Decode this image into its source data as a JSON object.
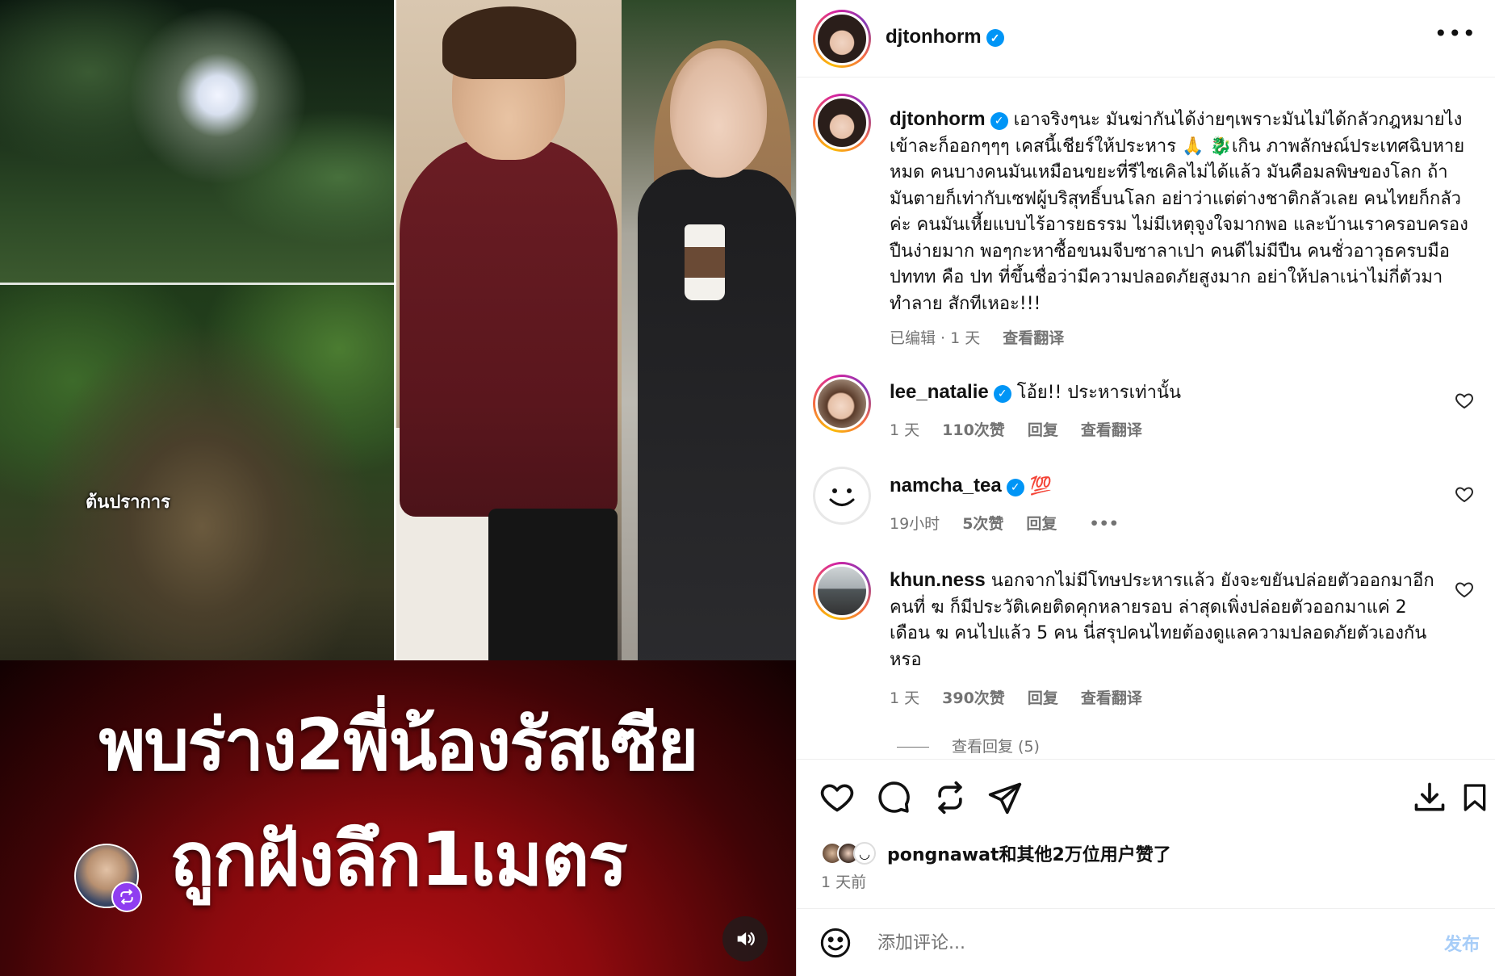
{
  "media": {
    "headline_line1": "พบร่าง2พี่น้องรัสเซีย",
    "headline_line2": "ถูกฝังลึก1เมตร",
    "inset_label": "ต้นปราการ",
    "repost_icon": "repost-icon",
    "sound_icon": "speaker-icon"
  },
  "post": {
    "username": "djtonhorm",
    "more_icon": "more-dots-icon"
  },
  "caption": {
    "username": "djtonhorm",
    "text": "เอาจริงๆนะ มันฆ่ากันได้ง่ายๆเพราะมันไม่ได้กลัวกฎหมายไง เข้าละก็ออกๆๆๆ เคสนี้เชียร์ให้ประหาร 🙏 🐉เกิน ภาพลักษณ์ประเทศฉิบหายหมด คนบางคนมันเหมือนขยะที่รีไซเคิลไม่ได้แล้ว มันคือมลพิษของโลก ถ้ามันตายก็เท่ากับเซฟผู้บริสุทธิ์บนโลก อย่าว่าแต่ต่างชาติกลัวเลย คนไทยก็กลัวค่ะ คนมันเหี้ยแบบไร้อารยธรรม ไม่มีเหตุจูงใจมากพอ และบ้านเราครอบครองปืนง่ายมาก พอๆกะหาซื้อขนมจีบซาลาเปา คนดีไม่มีปืน คนชั่วอาวุธครบมือ ปททท คือ ปท ที่ขึ้นชื่อว่ามีความปลอดภัยสูงมาก อย่าให้ปลาเน่าไม่กี่ตัวมาทำลาย สักทีเหอะ!!!",
    "edited": "已编辑 · 1 天",
    "translate": "查看翻译"
  },
  "comments": [
    {
      "username": "lee_natalie",
      "text": "โอ้ย!! ประหารเท่านั้น",
      "time": "1 天",
      "likes": "110次赞",
      "reply": "回复",
      "translate": "查看翻译"
    },
    {
      "username": "namcha_tea",
      "text": "💯",
      "time": "19小时",
      "likes": "5次赞",
      "reply": "回复",
      "more": "•••"
    },
    {
      "username": "khun.ness",
      "text": "นอกจากไม่มีโทษประหารแล้ว ยังจะขยันปล่อยตัวออกมาอีก คนที่ ฆ ก็มีประวัติเคยติดคุกหลายรอบ ล่าสุดเพิ่งปล่อยตัวออกมาแค่ 2 เดือน ฆ คนไปแล้ว 5 คน นี่สรุปคนไทยต้องดูแลความปลอดภัยตัวเองกันหรอ",
      "time": "1 天",
      "likes": "390次赞",
      "reply": "回复",
      "translate": "查看翻译"
    }
  ],
  "view_replies": "查看回复 (5)",
  "actions": {
    "icons": [
      "heart-icon",
      "comment-icon",
      "repost-icon",
      "share-icon",
      "download-icon",
      "bookmark-icon"
    ],
    "likes_text": "pongnawat和其他2万位用户赞了",
    "time_ago": "1 天前"
  },
  "comment_box": {
    "placeholder": "添加评论...",
    "post_label": "发布",
    "emoji_icon": "emoji-icon"
  },
  "colors": {
    "accent_blue": "#0095f6",
    "post_button_disabled": "#a7cdf8",
    "secondary_text": "#737373"
  }
}
